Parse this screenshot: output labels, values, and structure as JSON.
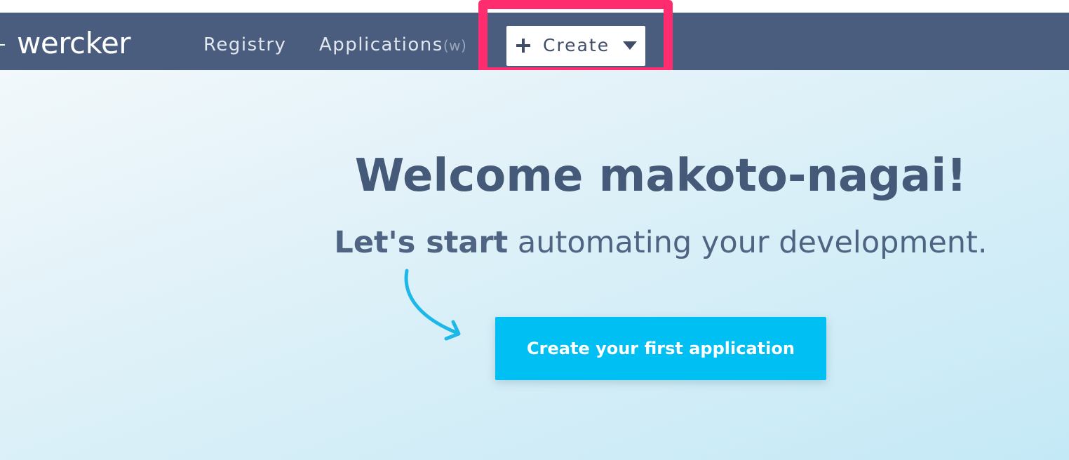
{
  "navbar": {
    "logo_text": "wercker",
    "links": [
      {
        "label": "Registry"
      },
      {
        "label": "Applications",
        "count": "(w)"
      }
    ],
    "create_menu": {
      "label": "Create",
      "icon": "plus-icon",
      "dropdown_icon": "caret-down-icon"
    },
    "background_color": "#4a5d7e"
  },
  "annotation": {
    "highlight_color": "#ff2d6f"
  },
  "hero": {
    "title": "Welcome makoto-nagai!",
    "subtitle_bold": "Let's start",
    "subtitle_rest": " automating your development.",
    "cta_label": "Create your first application",
    "cta_color": "#00bff3",
    "arrow_icon": "curved-arrow-icon"
  }
}
